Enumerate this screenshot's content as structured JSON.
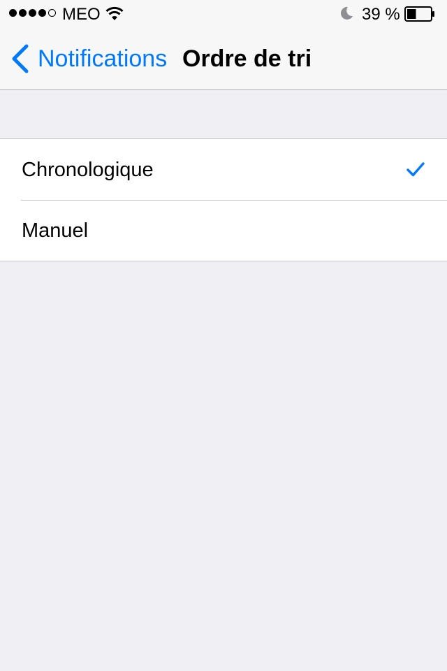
{
  "status_bar": {
    "signal_bars_filled": 4,
    "signal_bars_total": 5,
    "carrier": "MEO",
    "battery_percent": "39 %",
    "battery_level": 0.39,
    "icons": [
      "wifi-icon",
      "do-not-disturb-moon-icon",
      "battery-icon"
    ]
  },
  "nav": {
    "back_label": "Notifications",
    "title": "Ordre de tri"
  },
  "options": [
    {
      "label": "Chronologique",
      "selected": true
    },
    {
      "label": "Manuel",
      "selected": false
    }
  ],
  "colors": {
    "accent": "#0079ff",
    "background": "#efeff4",
    "separator": "#c8c7cc"
  }
}
